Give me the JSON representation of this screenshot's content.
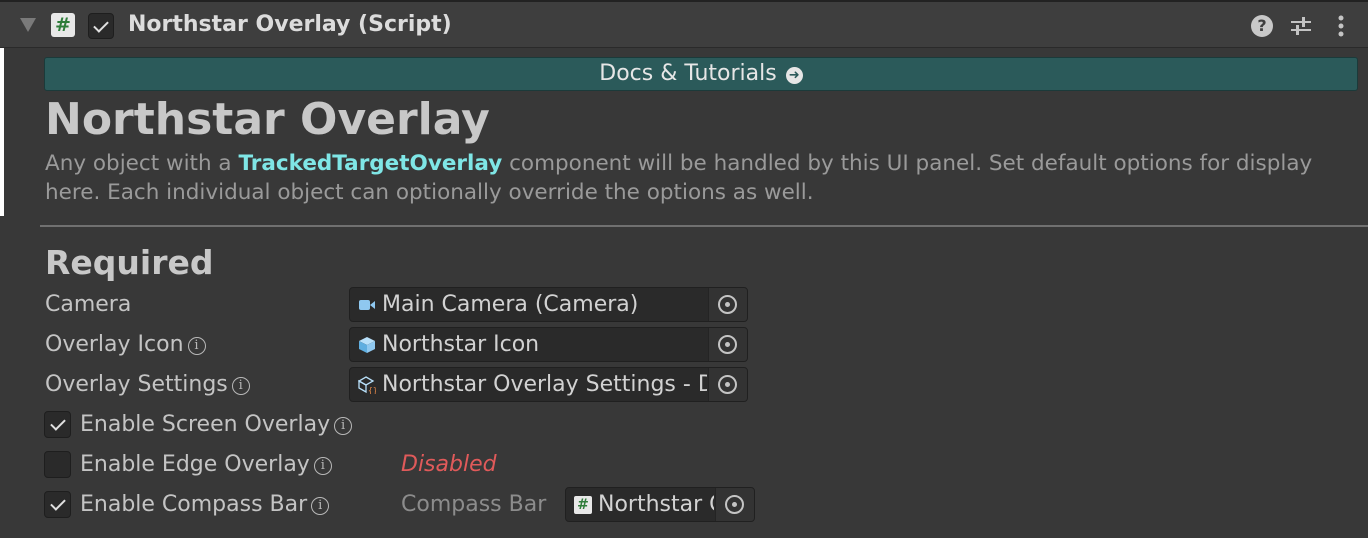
{
  "header": {
    "title": "Northstar Overlay (Script)",
    "script_icon": "hash-script-icon",
    "help_icon": "?",
    "enabled": true
  },
  "docs_button": {
    "label": "Docs & Tutorials",
    "icon": "➜"
  },
  "main": {
    "title": "Northstar Overlay",
    "description_prefix": "Any object with a ",
    "description_highlight": "TrackedTargetOverlay",
    "description_suffix": " component will be handled by this UI panel. Set default options for display here. Each individual object can optionally override the options as well."
  },
  "required": {
    "section_title": "Required",
    "fields": [
      {
        "label": "Camera",
        "value": "Main Camera (Camera)",
        "icon": "camera-icon",
        "has_info": false
      },
      {
        "label": "Overlay Icon",
        "value": "Northstar Icon",
        "icon": "prefab-cube-icon",
        "has_info": true
      },
      {
        "label": "Overlay Settings",
        "value": "Northstar Overlay Settings - D",
        "icon": "scriptable-object-icon",
        "has_info": true
      }
    ],
    "toggles": [
      {
        "label": "Enable Screen Overlay",
        "checked": true
      },
      {
        "label": "Enable Edge Overlay",
        "checked": false
      },
      {
        "label": "Enable Compass Bar",
        "checked": true
      }
    ],
    "edge_status": "Disabled",
    "compass_bar": {
      "label": "Compass Bar",
      "value": "Northstar C"
    }
  },
  "info_glyph": "i",
  "hash_glyph": "#",
  "colors": {
    "background": "#383838",
    "docs_button": "#2b5a5a",
    "highlight": "#7fe6e6",
    "disabled_text": "#e05a5a"
  }
}
